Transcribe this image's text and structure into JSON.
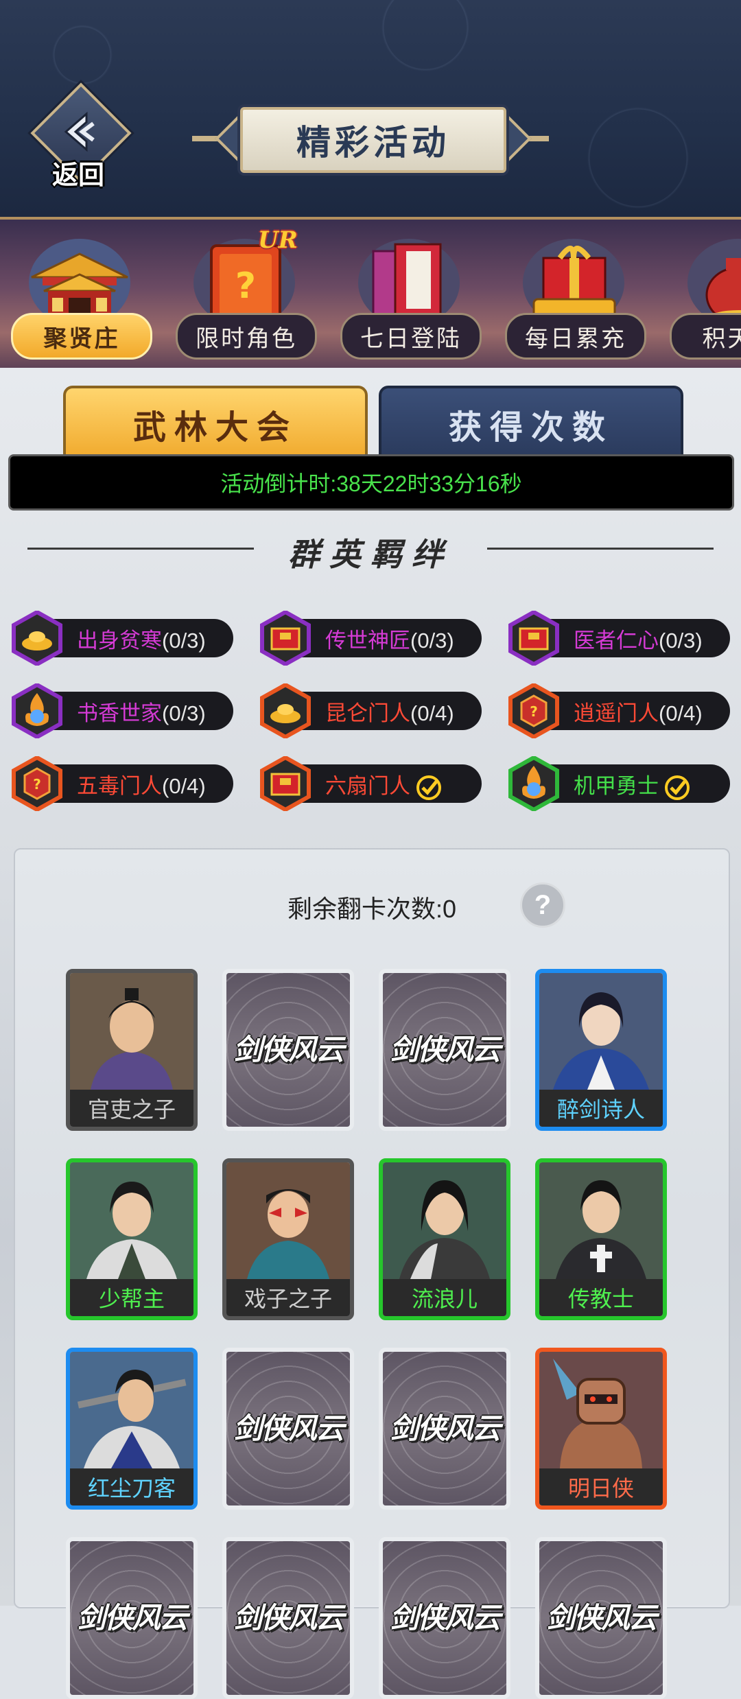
{
  "header": {
    "back_label": "返回",
    "title": "精彩活动"
  },
  "tabs": [
    {
      "label": "聚贤庄",
      "active": true
    },
    {
      "label": "限时角色",
      "active": false,
      "badge": "UR"
    },
    {
      "label": "七日登陆",
      "active": false
    },
    {
      "label": "每日累充",
      "active": false
    },
    {
      "label": "积天好",
      "active": false
    }
  ],
  "sub_tabs": {
    "wulin": "武林大会",
    "obtain": "获得次数"
  },
  "countdown": "活动倒计时:38天22时33分16秒",
  "bond_section": {
    "title": "群英羁绊",
    "items": [
      {
        "name": "出身贫寒",
        "count": "(0/3)",
        "color": "#d63bd6",
        "icon": "gold-ingot-icon",
        "frame": "#8a2fc2",
        "done": false
      },
      {
        "name": "传世神匠",
        "count": "(0/3)",
        "color": "#d63bd6",
        "icon": "token-box-icon",
        "frame": "#8a2fc2",
        "done": false
      },
      {
        "name": "医者仁心",
        "count": "(0/3)",
        "color": "#d63bd6",
        "icon": "token-box-icon",
        "frame": "#8a2fc2",
        "done": false
      },
      {
        "name": "书香世家",
        "count": "(0/3)",
        "color": "#d63bd6",
        "icon": "flame-orb-icon",
        "frame": "#8a2fc2",
        "done": false
      },
      {
        "name": "昆仑门人",
        "count": "(0/4)",
        "color": "#ff4a36",
        "icon": "gold-ingot-icon",
        "frame": "#e8551f",
        "done": false
      },
      {
        "name": "逍遥门人",
        "count": "(0/4)",
        "color": "#ff4a36",
        "icon": "mystery-box-icon",
        "frame": "#e8551f",
        "done": false
      },
      {
        "name": "五毒门人",
        "count": "(0/4)",
        "color": "#ff4a36",
        "icon": "mystery-box-icon",
        "frame": "#e8551f",
        "done": false
      },
      {
        "name": "六扇门人",
        "count": "",
        "color": "#ff4a36",
        "icon": "token-box-icon",
        "frame": "#e8551f",
        "done": true
      },
      {
        "name": "机甲勇士",
        "count": "",
        "color": "#44e04a",
        "icon": "flame-orb-icon",
        "frame": "#2fb83a",
        "done": true
      }
    ]
  },
  "cards_panel": {
    "flips_label": "剩余翻卡次数:0",
    "help": "?",
    "back_logo": "剑侠风云",
    "cards": [
      {
        "name": "官吏之子",
        "rarity": "gray",
        "revealed": true
      },
      {
        "name": "",
        "rarity": "back",
        "revealed": false
      },
      {
        "name": "",
        "rarity": "back",
        "revealed": false
      },
      {
        "name": "醉剑诗人",
        "rarity": "blue",
        "revealed": true
      },
      {
        "name": "少帮主",
        "rarity": "green",
        "revealed": true
      },
      {
        "name": "戏子之子",
        "rarity": "gray",
        "revealed": true
      },
      {
        "name": "流浪儿",
        "rarity": "green",
        "revealed": true
      },
      {
        "name": "传教士",
        "rarity": "green",
        "revealed": true
      },
      {
        "name": "红尘刀客",
        "rarity": "blue",
        "revealed": true
      },
      {
        "name": "",
        "rarity": "back",
        "revealed": false
      },
      {
        "name": "",
        "rarity": "back",
        "revealed": false
      },
      {
        "name": "明日侠",
        "rarity": "orange",
        "revealed": true
      },
      {
        "name": "",
        "rarity": "back",
        "revealed": false
      },
      {
        "name": "",
        "rarity": "back",
        "revealed": false
      },
      {
        "name": "",
        "rarity": "back",
        "revealed": false
      },
      {
        "name": "",
        "rarity": "back",
        "revealed": false
      }
    ]
  }
}
